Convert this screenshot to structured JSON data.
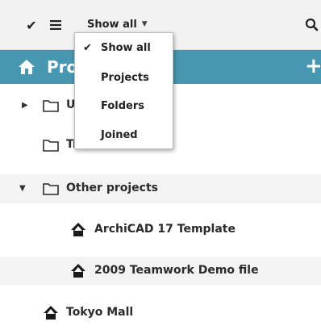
{
  "toolbar": {
    "select_icon": "check-icon",
    "menu_icon": "list-menu-icon",
    "filter_label": "Show all",
    "search_icon": "search-icon"
  },
  "header": {
    "title": "Projects",
    "add_icon": "plus-icon",
    "home_icon": "house-icon"
  },
  "dropdown": {
    "items": [
      {
        "label": "Show all",
        "checked": true
      },
      {
        "label": "Projects",
        "checked": false
      },
      {
        "label": "Folders",
        "checked": false
      },
      {
        "label": "Joined",
        "checked": false
      }
    ]
  },
  "tree": {
    "rows": [
      {
        "label": "U",
        "type": "folder",
        "expanded": false
      },
      {
        "label": "Trash",
        "type": "folder"
      },
      {
        "label": "Other projects",
        "type": "folder",
        "expanded": true
      },
      {
        "label": "ArchiCAD 17 Template",
        "type": "project"
      },
      {
        "label": "2009 Teamwork Demo file",
        "type": "project"
      },
      {
        "label": "Tokyo Mall",
        "type": "project"
      }
    ]
  },
  "colors": {
    "header_bg": "#4797b1",
    "toolbar_bg": "#f2f2f2",
    "row_alt_bg": "#f3f3f3"
  }
}
